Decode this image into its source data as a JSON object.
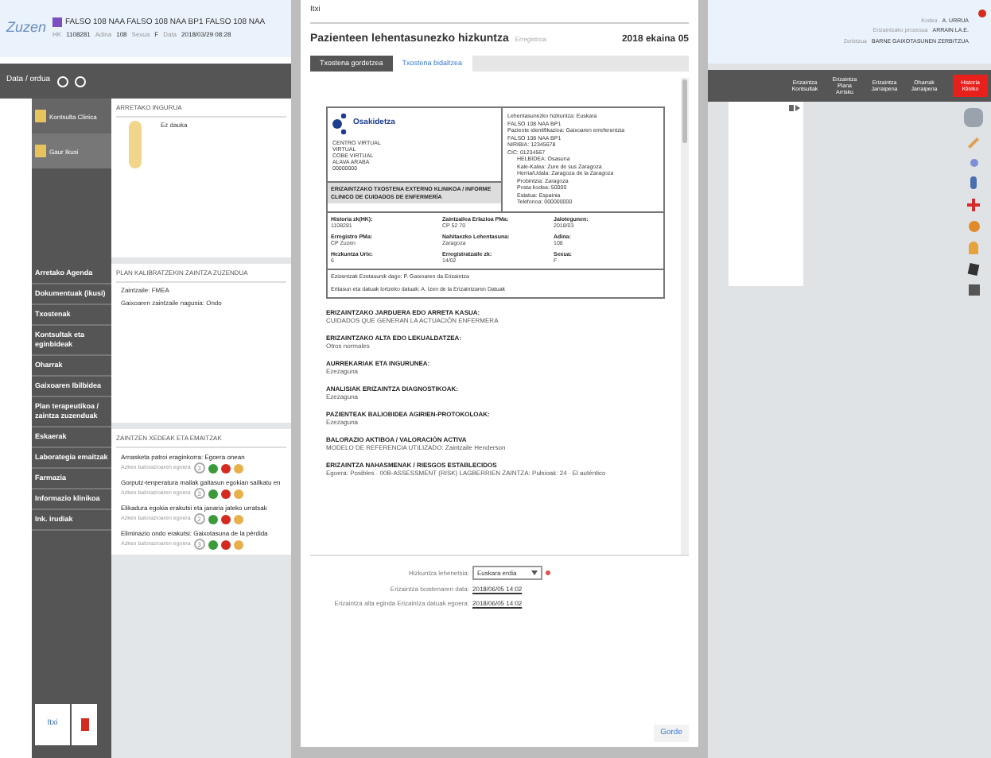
{
  "app": {
    "logo": "Zuzen",
    "patient_name": "FALSO 108 NAA FALSO 108 NAA BP1 FALSO 108 NAA",
    "patient_details": [
      {
        "label": "HK",
        "value": "1108281"
      },
      {
        "label": "Adina",
        "value": "108"
      },
      {
        "label": "Sexua",
        "value": "F"
      },
      {
        "label": "Data",
        "value": "2018/03/29 08:28"
      }
    ],
    "toolbar_label": "Data / ordua",
    "side_items": [
      {
        "label": "Kontsulta Clinica",
        "selected": false
      },
      {
        "label": "Gaur Ikusi",
        "selected": true
      }
    ],
    "nav_items": [
      "Arretako Agenda",
      "Dokumentuak (ikusi)",
      "Txostenak",
      "Kontsultak eta eginbideak",
      "Oharrak",
      "Gaixoaren Ibilbidea",
      "Plan terapeutikoa / zaintza zuzenduak",
      "Eskaerak",
      "Laborategia emaitzak",
      "Farmazia",
      "Informazio klinikoa",
      "Ink. irudiak"
    ],
    "sections": [
      {
        "title": "ARRETAKO INGURUA",
        "items": [
          "Ez dauka"
        ]
      },
      {
        "title": "PLAN KALIBRATZEKIN ZAINTZA ZUZENDUA",
        "items": [
          "Zaintzaile: FMEA",
          "Gaixoaren zaintzaile nagusia: Ondo"
        ]
      }
    ],
    "care_title": "ZAINTZEN XEDEAK ETA EMAITZAK",
    "care_items": [
      {
        "text": "Arnasketa patroi eraginkorra: Egoera onean",
        "sub": "Azken balorazioaren egoera",
        "badge": "3",
        "dots": [
          {
            "color": "#3c9a3c"
          },
          {
            "color": "#d52b1e"
          },
          {
            "color": "#e8b04a"
          }
        ]
      },
      {
        "text": "Gorputz-tenperatura mailak gaitasun egokian sailkatu en",
        "sub": "Azken balorazioaren egoera",
        "badge": "3",
        "dots": [
          {
            "color": "#3c9a3c"
          },
          {
            "color": "#d52b1e"
          },
          {
            "color": "#e8b04a"
          }
        ]
      },
      {
        "text": "Elikadura egokia erakutsi eta janaria jateko urratsak",
        "sub": "Azken balorazioaren egoera",
        "badge": "2",
        "dots": [
          {
            "color": "#3c9a3c"
          },
          {
            "color": "#d52b1e"
          },
          {
            "color": "#e8b04a"
          }
        ]
      },
      {
        "text": "Eliminazio ondo erakutsi: Gaixotasuna de la pérdida",
        "sub": "Azken balorazioaren egoera",
        "badge": "3",
        "dots": [
          {
            "color": "#3c9a3c"
          },
          {
            "color": "#d52b1e"
          },
          {
            "color": "#e8b04a"
          }
        ]
      }
    ],
    "bottom_buttons": [
      "Itxi"
    ]
  },
  "dialog": {
    "close_label": "Itxi",
    "title": "Pazienteen lehentasunezko hizkuntza",
    "subtitle": "Erregistroa",
    "date": "2018 ekaina 05",
    "tabs": [
      {
        "label": "Txostena gordetzea",
        "selected": true
      },
      {
        "label": "Txostena bidaltzea",
        "selected": false
      }
    ],
    "report": {
      "org": "Osakidetza",
      "org_lines": [
        "CENTRO VIRTUAL",
        "VIRTUAL",
        "COBE VIRTUAL",
        "ALAVA ARABA",
        "00000000"
      ],
      "doc_title": "ERIZAINTZAKO TXOSTENA EXTERNO KLINIKOA / INFORME CLINICO DE CUIDADOS DE ENFERMERÍA",
      "address_lines": [
        "Lehentasunezko hizkuntza: Euskara",
        "FALSO 108 NAA BP1",
        "Paziente identifikazioa: Gaixoaren erreferentzia",
        "FALSO 108 NAA BP1",
        "NIRIBIA: 12345678",
        "CIC: 01234567",
        "HELBIDEA: Osasuna",
        "Kale-Kalea: Zure de sus Zaragoza",
        "Herria/Udala: Zaragoza de la Zaragoza",
        "Probintzia: Zaragoza",
        "Posta kodea: 50000",
        "Estatua: Espainia",
        "Telefonoa: 000000000"
      ],
      "fields": [
        {
          "label": "Historia zk(HK):",
          "value": "1108281"
        },
        {
          "label": "Zaintzailea Erlazioa PMa:",
          "value": "CP 52 70"
        },
        {
          "label": "Jaiotegunen:",
          "value": "2018/03"
        },
        {
          "label": "Erregistro PMa:",
          "value": "CP Zuzen"
        },
        {
          "label": "Nahitaezko Lehentasuna:",
          "value": "Zaragoza"
        },
        {
          "label": "Adina:",
          "value": "108"
        },
        {
          "label": "Hezkuntza Urte:",
          "value": "6"
        },
        {
          "label": "Erregistratzaile zk:",
          "value": "14/02"
        },
        {
          "label": "Sexua:",
          "value": "F"
        }
      ],
      "notes": [
        "Ezizentzak Ezetasunik dago: P. Gaixoaren da Erizaintza",
        "Eritasun eta datuak lortzeko datuak: A. Izen de la Erizaintzaren Datuak"
      ],
      "sections": [
        {
          "heading": "ERIZAINTZAKO JARDUERA EDO ARRETA KASUA:",
          "value": "CUIDADOS QUE GENERAN LA ACTUACIÓN ENFERMERA"
        },
        {
          "heading": "ERIZAINTZAKO ALTA EDO LEKUALDATZEA:",
          "value": "Otros normales"
        },
        {
          "heading": "AURREKARIAK ETA INGURUNEA:",
          "value": "Ezezaguna"
        },
        {
          "heading": "ANALISIAK ERIZAINTZA DIAGNOSTIKOAK:",
          "value": "Ezezaguna"
        },
        {
          "heading": "PAZIENTEAK BALIOBIDEA AGIRIEN-PROTOKOLOAK:",
          "value": "Ezezaguna"
        },
        {
          "heading": "BALORAZIO AKTIBOA / VALORACIÓN ACTIVA",
          "value": "MODELO DE REFERENCIA UTILIZADO: Zaintzaile Henderson"
        },
        {
          "heading": "ERIZAINTZA NAHASMENAK / RIESGOS ESTABLECIDOS",
          "value": "Egoera: Posibles · 00B-ASSESSMENT (RISK) LAGBERRIEN ZAINTZA: Pulsioak: 24 · El auténtico"
        }
      ]
    },
    "form": [
      {
        "label": "Hizkuntza lehenetsia:",
        "value": "Euskara erdia",
        "kind": "select",
        "required": true
      },
      {
        "label": "Erizaintza txostenaren data:",
        "value": "2018/06/05 14:02",
        "kind": "text",
        "required": false
      },
      {
        "label": "Erizaintza alta eginda Erizaintza datuak egoera:",
        "value": "2018/06/05 14:02",
        "kind": "text",
        "required": false
      }
    ],
    "save_button": "Gorde"
  },
  "right": {
    "header_lines": [
      {
        "label": "Kodea",
        "value": "A. URRUA"
      },
      {
        "label": "Erizaintzako prozesua",
        "value": "ARRAIN LA.E."
      },
      {
        "label": "Zerbitzua",
        "value": "BARNE GAIXOTASUNEN ZERBITZUA"
      }
    ],
    "buttons": [
      {
        "label": "Erizaintza Kontsultak",
        "alert": false
      },
      {
        "label": "Erizaintza Plana Arrisku",
        "alert": false
      },
      {
        "label": "Erizaintza Jarraipena",
        "alert": false
      },
      {
        "label": "Oharrak Jarraipena",
        "alert": false
      },
      {
        "label": "Historia Kliniko",
        "alert": true
      }
    ]
  }
}
